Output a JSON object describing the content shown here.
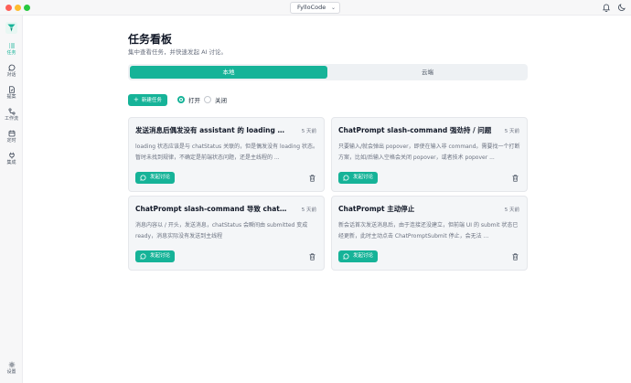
{
  "window": {
    "project_selector": "FylloCode"
  },
  "icons": {
    "notifications": "bell-icon",
    "theme": "moon-icon",
    "logo": "fyllo-logo"
  },
  "colors": {
    "accent": "#16b398",
    "traffic_close": "#fe5f57",
    "traffic_minimize": "#febc2e",
    "traffic_maximize": "#28c840"
  },
  "sidebar": {
    "items": [
      {
        "label": "任务",
        "icon": "tasks-icon",
        "active": true
      },
      {
        "label": "对话",
        "icon": "chat-icon",
        "active": false
      },
      {
        "label": "提案",
        "icon": "proposal-icon",
        "active": false
      },
      {
        "label": "工作流",
        "icon": "workflow-icon",
        "active": false
      },
      {
        "label": "定时",
        "icon": "calendar-icon",
        "active": false
      },
      {
        "label": "集成",
        "icon": "plug-icon",
        "active": false
      }
    ],
    "settings_label": "设置"
  },
  "header": {
    "title": "任务看板",
    "subtitle": "集中查看任务，并快速发起 AI 讨论。"
  },
  "tabs": [
    {
      "label": "本地",
      "selected": true
    },
    {
      "label": "云端",
      "selected": false
    }
  ],
  "toolbar": {
    "new_task_label": "新建任务",
    "filter_open_label": "打开",
    "filter_closed_label": "关闭",
    "filter_selected": "打开"
  },
  "cards": [
    {
      "title": "发送消息后偶发没有 assistant 的 loading 状态",
      "time": "5 天前",
      "description": "loading 状态应该是与 chatStatus 关联的，但是偶发没有 loading 状态。暂时未找到规律，不确定是前端状态问题，还是主线程的 ...",
      "action_label": "发起讨论"
    },
    {
      "title": "ChatPrompt slash-command 强劲持 / 问题",
      "time": "5 天前",
      "description": "只要输入/就会弹出 popover，即使在输入非 command。需要找一个打断方案，比如/后输入空格会关闭 popover，或者技术 popover ...",
      "action_label": "发起讨论"
    },
    {
      "title": "ChatPrompt slash-command 导致 chatStatus 异常",
      "time": "5 天前",
      "description": "消息内容以 / 开头，发送消息，chatStatus 会瞬间由 submitted 变成 ready，消息实际没有发送到主线程",
      "action_label": "发起讨论"
    },
    {
      "title": "ChatPrompt 主动停止",
      "time": "5 天前",
      "description": "新会话首次发送消息后，由于连接还没建立，但前端 UI 的 submit 状态已经更新，此时主动点击 ChatPromptSubmit 停止，会无法 ...",
      "action_label": "发起讨论"
    }
  ]
}
